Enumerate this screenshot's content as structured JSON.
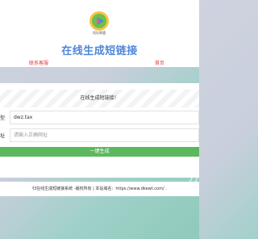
{
  "header": {
    "logo_text": "短址联盟",
    "title": "在线生成短链接",
    "nav": {
      "left": "联系客服",
      "right": "首页"
    }
  },
  "form": {
    "heading": "在线生成短链接！",
    "type_label": "型",
    "type_value": "dwz.tax",
    "url_label": "址",
    "url_placeholder": "请输入正确网址",
    "submit": "一键生成"
  },
  "footer": {
    "text": "归在线生成短链接系统 -版权所有 | 本站域名：https://www.dkewt.com/ ."
  },
  "colors": {
    "title": "#4f86d8",
    "nav": "#e03c3c",
    "button": "#5cb85c"
  }
}
